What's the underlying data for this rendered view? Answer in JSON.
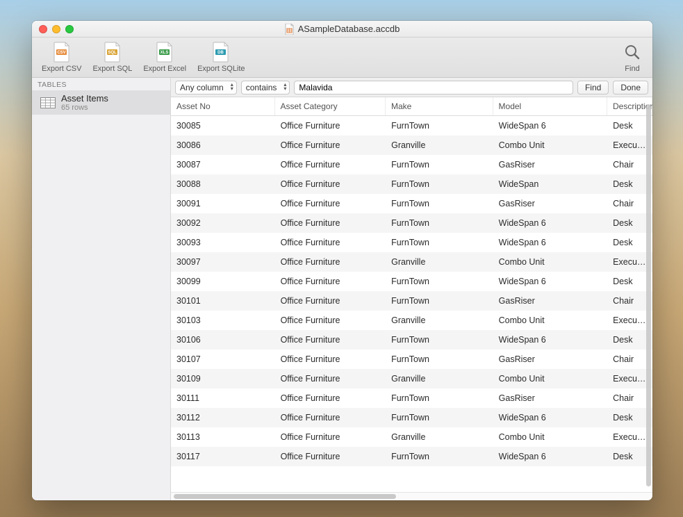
{
  "window": {
    "title": "ASampleDatabase.accdb"
  },
  "toolbar": {
    "export_csv": "Export CSV",
    "export_sql": "Export SQL",
    "export_excel": "Export Excel",
    "export_sqlite": "Export SQLite",
    "find": "Find"
  },
  "sidebar": {
    "header": "TABLES",
    "items": [
      {
        "name": "Asset Items",
        "sub": "65 rows"
      }
    ]
  },
  "searchbar": {
    "column_select": "Any column",
    "match_select": "contains",
    "input_value": "Malavida",
    "find_button": "Find",
    "done_button": "Done"
  },
  "table": {
    "columns": [
      "Asset No",
      "Asset Category",
      "Make",
      "Model",
      "Description"
    ],
    "rows": [
      {
        "asset_no": "30085",
        "category": "Office Furniture",
        "make": "FurnTown",
        "model": "WideSpan 6",
        "desc": "Desk"
      },
      {
        "asset_no": "30086",
        "category": "Office Furniture",
        "make": "Granville",
        "model": "Combo Unit",
        "desc": "Executive"
      },
      {
        "asset_no": "30087",
        "category": "Office Furniture",
        "make": "FurnTown",
        "model": "GasRiser",
        "desc": "Chair"
      },
      {
        "asset_no": "30088",
        "category": "Office Furniture",
        "make": "FurnTown",
        "model": "WideSpan",
        "desc": "Desk"
      },
      {
        "asset_no": "30091",
        "category": "Office Furniture",
        "make": "FurnTown",
        "model": "GasRiser",
        "desc": "Chair"
      },
      {
        "asset_no": "30092",
        "category": "Office Furniture",
        "make": "FurnTown",
        "model": "WideSpan 6",
        "desc": "Desk"
      },
      {
        "asset_no": "30093",
        "category": "Office Furniture",
        "make": "FurnTown",
        "model": "WideSpan 6",
        "desc": "Desk"
      },
      {
        "asset_no": "30097",
        "category": "Office Furniture",
        "make": "Granville",
        "model": "Combo Unit",
        "desc": "Executive"
      },
      {
        "asset_no": "30099",
        "category": "Office Furniture",
        "make": "FurnTown",
        "model": "WideSpan 6",
        "desc": "Desk"
      },
      {
        "asset_no": "30101",
        "category": "Office Furniture",
        "make": "FurnTown",
        "model": "GasRiser",
        "desc": "Chair"
      },
      {
        "asset_no": "30103",
        "category": "Office Furniture",
        "make": "Granville",
        "model": "Combo Unit",
        "desc": "Executive"
      },
      {
        "asset_no": "30106",
        "category": "Office Furniture",
        "make": "FurnTown",
        "model": "WideSpan 6",
        "desc": "Desk"
      },
      {
        "asset_no": "30107",
        "category": "Office Furniture",
        "make": "FurnTown",
        "model": "GasRiser",
        "desc": "Chair"
      },
      {
        "asset_no": "30109",
        "category": "Office Furniture",
        "make": "Granville",
        "model": "Combo Unit",
        "desc": "Executive"
      },
      {
        "asset_no": "30111",
        "category": "Office Furniture",
        "make": "FurnTown",
        "model": "GasRiser",
        "desc": "Chair"
      },
      {
        "asset_no": "30112",
        "category": "Office Furniture",
        "make": "FurnTown",
        "model": "WideSpan 6",
        "desc": "Desk"
      },
      {
        "asset_no": "30113",
        "category": "Office Furniture",
        "make": "Granville",
        "model": "Combo Unit",
        "desc": "Executive"
      },
      {
        "asset_no": "30117",
        "category": "Office Furniture",
        "make": "FurnTown",
        "model": "WideSpan 6",
        "desc": "Desk"
      }
    ]
  },
  "icon_colors": {
    "csv": "#e68b3b",
    "sql": "#d9a333",
    "xls": "#3a9c4a",
    "db": "#2c9bb0"
  }
}
